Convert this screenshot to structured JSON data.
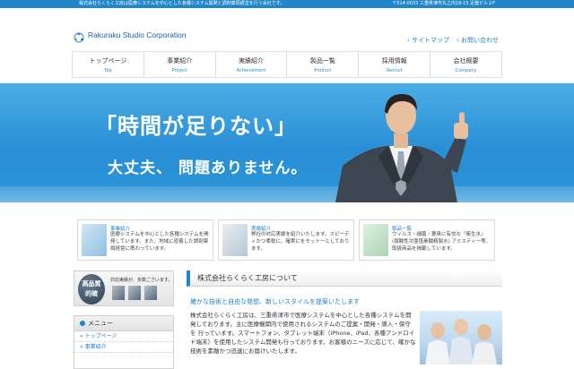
{
  "topbar": {
    "left": "株式会社らくらく工房は医療システムを中心とした各種システム開発と調剤薬局経営を行う会社です。",
    "right": "〒514-0033 三重県津市丸之内18-15 近畿ビル２F"
  },
  "logo": {
    "name": "Rakuraku Studio Corporation"
  },
  "util": {
    "sitemap": "サイトマップ",
    "contact": "お問い合わせ"
  },
  "nav": [
    {
      "jp": "トップページ",
      "en": "Top"
    },
    {
      "jp": "事業紹介",
      "en": "Project"
    },
    {
      "jp": "実績紹介",
      "en": "Achievement"
    },
    {
      "jp": "製品一覧",
      "en": "Product"
    },
    {
      "jp": "採用情報",
      "en": "Recruit"
    },
    {
      "jp": "会社概要",
      "en": "Company"
    }
  ],
  "hero": {
    "line1": "「時間が足りない」",
    "line2": "大丈夫、 問題ありません。"
  },
  "features": [
    {
      "title": "事業紹介",
      "text": "医療システムを中心とした各種システムを開発しています。また、地域に密着した調剤薬局経営に携わっています。"
    },
    {
      "title": "実績紹介",
      "text": "弊社の対応実績を紹介いたします。スピーディかつ柔軟に、確実にをモットーとしております。"
    },
    {
      "title": "製品一覧",
      "text": "ウィルス・細菌・悪臭に有効な『衛生水』(弱酸性次亜塩素酸精製水) アミスティー等、取扱商品を掲載しています。"
    }
  ],
  "banner": {
    "badge": "高品質\n的確",
    "text": "対応実績が、多数ございます。"
  },
  "menu": {
    "heading": "メニュー",
    "items": [
      "トップページ",
      "事業紹介"
    ]
  },
  "main": {
    "heading": "株式会社らくらく工房について",
    "subheading": "確かな技術と自由な発想、新しいスタイルを提案いたします",
    "body": "株式会社らくらく工房は、三重県津市で医療システムを中心とした各種システムを開発しております。主に医療機関内で使用されるシステムのご提案・開発・導入・保守を 行っています。スマートフォン、タブレット端末（iPhone、iPad、各種アンドロイド端末）を使用したシステム開発も行っております。お客様のニーズに応じて、確かな技術を素敵かつ迅速にお届けいたします。"
  },
  "colors": {
    "accent": "#1f86c9",
    "hero": "#2a8fd6"
  }
}
